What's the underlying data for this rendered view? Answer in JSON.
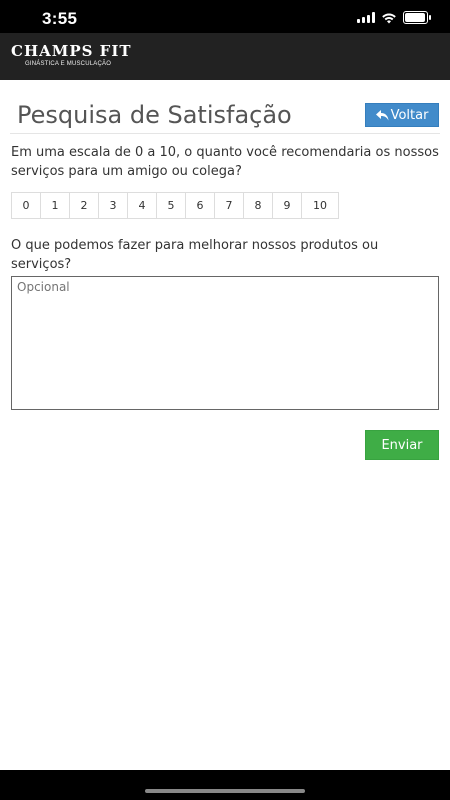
{
  "status_bar": {
    "time": "3:55"
  },
  "header": {
    "logo_title": "CHAMPS FIT",
    "logo_subtitle": "GINÁSTICA E MUSCULAÇÃO"
  },
  "page": {
    "title": "Pesquisa de Satisfação",
    "back_label": "Voltar",
    "question1": "Em uma escala de 0 a 10, o quanto você recomendaria os nossos serviços para um amigo ou colega?",
    "scale": [
      "0",
      "1",
      "2",
      "3",
      "4",
      "5",
      "6",
      "7",
      "8",
      "9",
      "10"
    ],
    "question2": "O que podemos fazer para melhorar nossos produtos ou serviços?",
    "textarea_placeholder": "Opcional",
    "textarea_value": "",
    "submit_label": "Enviar"
  },
  "colors": {
    "back_button": "#428bca",
    "submit_button": "#3fad46",
    "header_bg": "#222222"
  }
}
